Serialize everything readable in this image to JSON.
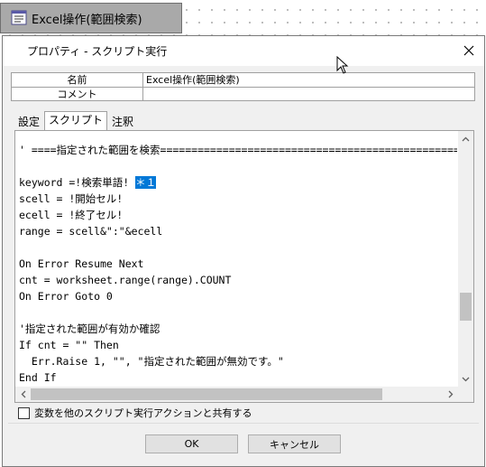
{
  "node": {
    "title": "Excel操作(範囲検索)",
    "icon": "script-window-icon"
  },
  "dialog": {
    "title": "プロパティ - スクリプト実行",
    "close_icon": "close-icon"
  },
  "properties": {
    "rows": [
      {
        "key": "名前",
        "value": "Excel操作(範囲検索)"
      },
      {
        "key": "コメント",
        "value": ""
      }
    ]
  },
  "tabs": [
    {
      "label": "設定",
      "active": false
    },
    {
      "label": "スクリプト",
      "active": true
    },
    {
      "label": "注釈",
      "active": false
    }
  ],
  "editor": {
    "lines": [
      {
        "text": "' ====指定された範囲を検索================================================"
      },
      {
        "text": ""
      },
      {
        "text": "keyword =!検索単語! ",
        "sel": "＊１"
      },
      {
        "text": "scell = !開始セル!"
      },
      {
        "text": "ecell = !終了セル!"
      },
      {
        "text": "range = scell&\":\"&ecell"
      },
      {
        "text": ""
      },
      {
        "text": "On Error Resume Next"
      },
      {
        "text": "cnt = worksheet.range(range).COUNT"
      },
      {
        "text": "On Error Goto 0"
      },
      {
        "text": ""
      },
      {
        "text": "'指定された範囲が有効か確認"
      },
      {
        "text": "If cnt = \"\" Then"
      },
      {
        "text": "  Err.Raise 1, \"\", \"指定された範囲が無効です。\""
      },
      {
        "text": "End If"
      }
    ]
  },
  "share": {
    "label": "変数を他のスクリプト実行アクションと共有する",
    "checked": false
  },
  "buttons": {
    "ok": "OK",
    "cancel": "キャンセル"
  }
}
